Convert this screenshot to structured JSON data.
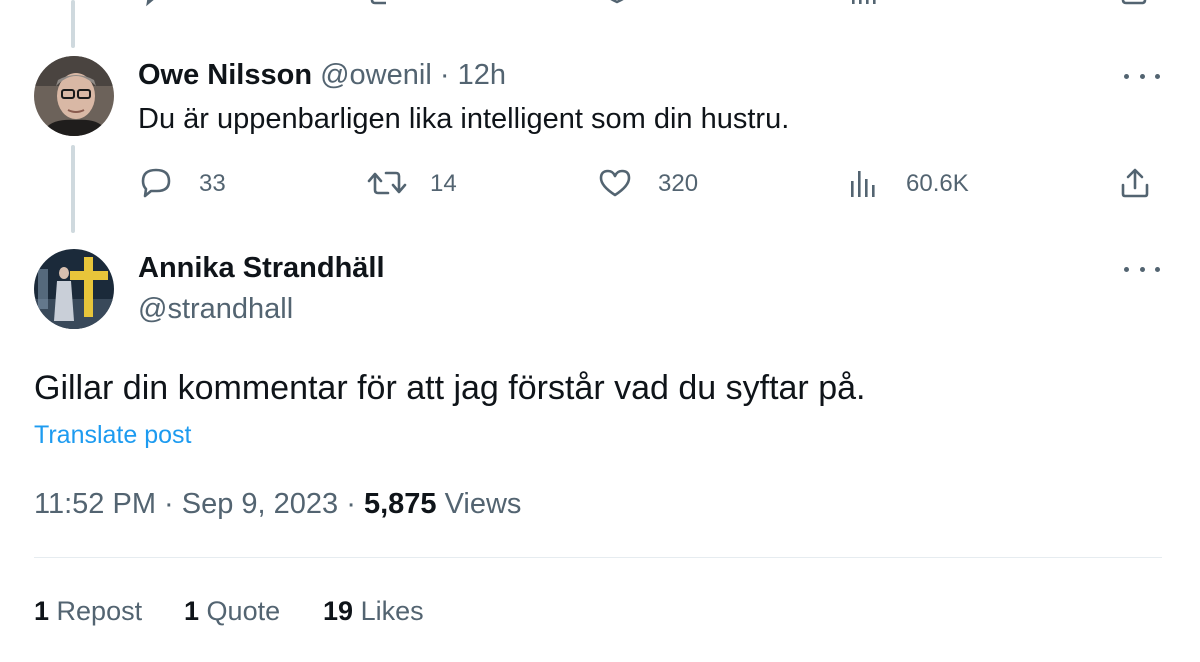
{
  "top_partial_actions": {
    "reply_icon": "reply-icon",
    "repost_icon": "repost-icon",
    "like_icon": "heart-icon",
    "views_icon": "views-icon",
    "bookmark_icon": "bookmark-icon"
  },
  "reply_post": {
    "display_name": "Owe Nilsson",
    "handle": "@owenil",
    "separator": "·",
    "time": "12h",
    "text": "Du är uppenbarligen lika intelligent som din hustru.",
    "stats": {
      "replies": "33",
      "reposts": "14",
      "likes": "320",
      "views": "60.6K"
    }
  },
  "main_post": {
    "display_name": "Annika Strandhäll",
    "handle": "@strandhall",
    "text": "Gillar din kommentar för att jag förstår vad du syftar på.",
    "translate_label": "Translate post",
    "timestamp": "11:52 PM · Sep 9, 2023 ·",
    "views_count": "5,875",
    "views_label": "Views",
    "engagement": {
      "reposts_count": "1",
      "reposts_label": "Repost",
      "quotes_count": "1",
      "quotes_label": "Quote",
      "likes_count": "19",
      "likes_label": "Likes"
    }
  },
  "colors": {
    "text": "#0f1419",
    "muted": "#536471",
    "link": "#1d9bf0",
    "thread_line": "#cfd9de"
  }
}
